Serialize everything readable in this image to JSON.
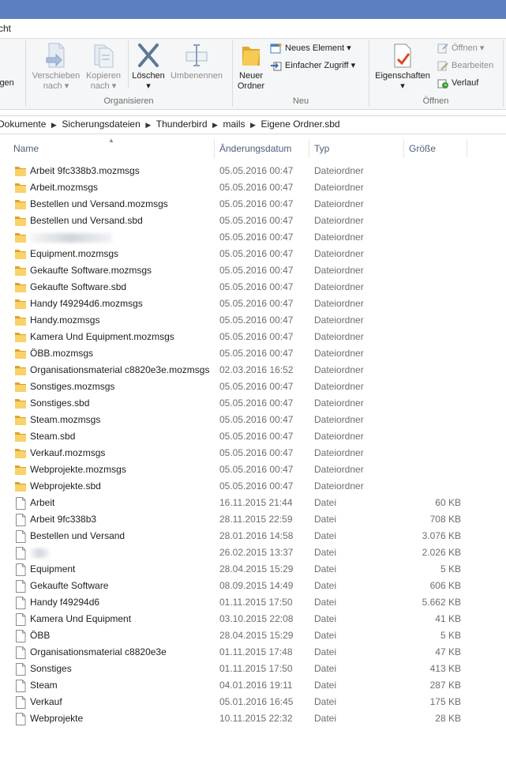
{
  "tabbar": {
    "tab_fragment": "cht"
  },
  "ribbon": {
    "partial_label": "igen",
    "organize": {
      "label": "Organisieren",
      "move_line1": "Verschieben",
      "move_line2": "nach",
      "copy_line1": "Kopieren",
      "copy_line2": "nach",
      "delete": "Löschen",
      "rename": "Umbenennen"
    },
    "new": {
      "label": "Neu",
      "folder_line1": "Neuer",
      "folder_line2": "Ordner",
      "new_item": "Neues Element",
      "easy_access": "Einfacher Zugriff"
    },
    "open": {
      "label": "Öffnen",
      "properties": "Eigenschaften",
      "open": "Öffnen",
      "edit": "Bearbeiten",
      "history": "Verlauf"
    }
  },
  "breadcrumb": [
    "Dokumente",
    "Sicherungsdateien",
    "Thunderbird",
    "mails",
    "Eigene Ordner.sbd"
  ],
  "columns": {
    "name": "Name",
    "date": "Änderungsdatum",
    "type": "Typ",
    "size": "Größe"
  },
  "files": [
    {
      "name": "Arbeit 9fc338b3.mozmsgs",
      "date": "05.05.2016 00:47",
      "type": "Dateiordner",
      "size": "",
      "kind": "folder",
      "blurred": false
    },
    {
      "name": "Arbeit.mozmsgs",
      "date": "05.05.2016 00:47",
      "type": "Dateiordner",
      "size": "",
      "kind": "folder",
      "blurred": false
    },
    {
      "name": "Bestellen und Versand.mozmsgs",
      "date": "05.05.2016 00:47",
      "type": "Dateiordner",
      "size": "",
      "kind": "folder",
      "blurred": false
    },
    {
      "name": "Bestellen und Versand.sbd",
      "date": "05.05.2016 00:47",
      "type": "Dateiordner",
      "size": "",
      "kind": "folder",
      "blurred": false
    },
    {
      "name": "",
      "date": "05.05.2016 00:47",
      "type": "Dateiordner",
      "size": "",
      "kind": "folder",
      "blurred": true
    },
    {
      "name": "Equipment.mozmsgs",
      "date": "05.05.2016 00:47",
      "type": "Dateiordner",
      "size": "",
      "kind": "folder",
      "blurred": false
    },
    {
      "name": "Gekaufte Software.mozmsgs",
      "date": "05.05.2016 00:47",
      "type": "Dateiordner",
      "size": "",
      "kind": "folder",
      "blurred": false
    },
    {
      "name": "Gekaufte Software.sbd",
      "date": "05.05.2016 00:47",
      "type": "Dateiordner",
      "size": "",
      "kind": "folder",
      "blurred": false
    },
    {
      "name": "Handy f49294d6.mozmsgs",
      "date": "05.05.2016 00:47",
      "type": "Dateiordner",
      "size": "",
      "kind": "folder",
      "blurred": false
    },
    {
      "name": "Handy.mozmsgs",
      "date": "05.05.2016 00:47",
      "type": "Dateiordner",
      "size": "",
      "kind": "folder",
      "blurred": false
    },
    {
      "name": "Kamera Und Equipment.mozmsgs",
      "date": "05.05.2016 00:47",
      "type": "Dateiordner",
      "size": "",
      "kind": "folder",
      "blurred": false
    },
    {
      "name": "ÖBB.mozmsgs",
      "date": "05.05.2016 00:47",
      "type": "Dateiordner",
      "size": "",
      "kind": "folder",
      "blurred": false
    },
    {
      "name": "Organisationsmaterial c8820e3e.mozmsgs",
      "date": "02.03.2016 16:52",
      "type": "Dateiordner",
      "size": "",
      "kind": "folder",
      "blurred": false
    },
    {
      "name": "Sonstiges.mozmsgs",
      "date": "05.05.2016 00:47",
      "type": "Dateiordner",
      "size": "",
      "kind": "folder",
      "blurred": false
    },
    {
      "name": "Sonstiges.sbd",
      "date": "05.05.2016 00:47",
      "type": "Dateiordner",
      "size": "",
      "kind": "folder",
      "blurred": false
    },
    {
      "name": "Steam.mozmsgs",
      "date": "05.05.2016 00:47",
      "type": "Dateiordner",
      "size": "",
      "kind": "folder",
      "blurred": false
    },
    {
      "name": "Steam.sbd",
      "date": "05.05.2016 00:47",
      "type": "Dateiordner",
      "size": "",
      "kind": "folder",
      "blurred": false
    },
    {
      "name": "Verkauf.mozmsgs",
      "date": "05.05.2016 00:47",
      "type": "Dateiordner",
      "size": "",
      "kind": "folder",
      "blurred": false
    },
    {
      "name": "Webprojekte.mozmsgs",
      "date": "05.05.2016 00:47",
      "type": "Dateiordner",
      "size": "",
      "kind": "folder",
      "blurred": false
    },
    {
      "name": "Webprojekte.sbd",
      "date": "05.05.2016 00:47",
      "type": "Dateiordner",
      "size": "",
      "kind": "folder",
      "blurred": false
    },
    {
      "name": "Arbeit",
      "date": "16.11.2015 21:44",
      "type": "Datei",
      "size": "60 KB",
      "kind": "file",
      "blurred": false
    },
    {
      "name": "Arbeit 9fc338b3",
      "date": "28.11.2015 22:59",
      "type": "Datei",
      "size": "708 KB",
      "kind": "file",
      "blurred": false
    },
    {
      "name": "Bestellen und Versand",
      "date": "28.01.2016 14:58",
      "type": "Datei",
      "size": "3.076 KB",
      "kind": "file",
      "blurred": false
    },
    {
      "name": "",
      "date": "26.02.2015 13:37",
      "type": "Datei",
      "size": "2.026 KB",
      "kind": "file",
      "blurred": true
    },
    {
      "name": "Equipment",
      "date": "28.04.2015 15:29",
      "type": "Datei",
      "size": "5 KB",
      "kind": "file",
      "blurred": false
    },
    {
      "name": "Gekaufte Software",
      "date": "08.09.2015 14:49",
      "type": "Datei",
      "size": "606 KB",
      "kind": "file",
      "blurred": false
    },
    {
      "name": "Handy f49294d6",
      "date": "01.11.2015 17:50",
      "type": "Datei",
      "size": "5.662 KB",
      "kind": "file",
      "blurred": false
    },
    {
      "name": "Kamera Und Equipment",
      "date": "03.10.2015 22:08",
      "type": "Datei",
      "size": "41 KB",
      "kind": "file",
      "blurred": false
    },
    {
      "name": "ÖBB",
      "date": "28.04.2015 15:29",
      "type": "Datei",
      "size": "5 KB",
      "kind": "file",
      "blurred": false
    },
    {
      "name": "Organisationsmaterial c8820e3e",
      "date": "01.11.2015 17:48",
      "type": "Datei",
      "size": "47 KB",
      "kind": "file",
      "blurred": false
    },
    {
      "name": "Sonstiges",
      "date": "01.11.2015 17:50",
      "type": "Datei",
      "size": "413 KB",
      "kind": "file",
      "blurred": false
    },
    {
      "name": "Steam",
      "date": "04.01.2016 19:11",
      "type": "Datei",
      "size": "287 KB",
      "kind": "file",
      "blurred": false
    },
    {
      "name": "Verkauf",
      "date": "05.01.2016 16:45",
      "type": "Datei",
      "size": "175 KB",
      "kind": "file",
      "blurred": false
    },
    {
      "name": "Webprojekte",
      "date": "10.11.2015 22:32",
      "type": "Datei",
      "size": "28 KB",
      "kind": "file",
      "blurred": false
    }
  ]
}
